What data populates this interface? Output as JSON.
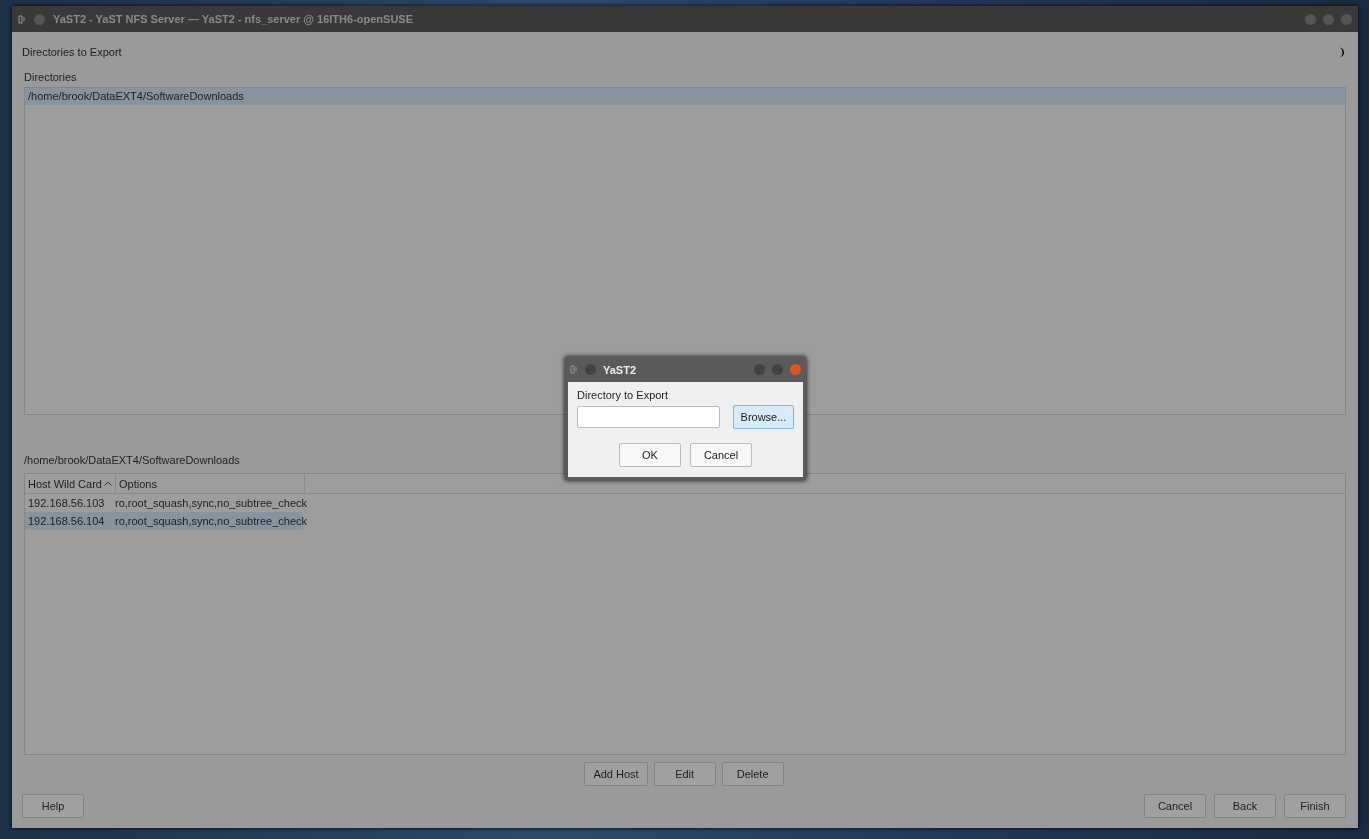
{
  "window": {
    "title": "YaST2 - YaST NFS Server — YaST2 - nfs_server @ 16ITH6-openSUSE"
  },
  "heading": "Directories to Export",
  "directories": {
    "label": "Directories",
    "items": [
      {
        "path": "/home/brook/DataEXT4/SoftwareDownloads",
        "selected": true
      }
    ]
  },
  "hosts": {
    "label": "/home/brook/DataEXT4/SoftwareDownloads",
    "columns": [
      {
        "title": "Host Wild Card",
        "sorted": true
      },
      {
        "title": "Options",
        "sorted": false
      }
    ],
    "rows": [
      {
        "host": "192.168.56.103",
        "options": "ro,root_squash,sync,no_subtree_check",
        "selected": false
      },
      {
        "host": "192.168.56.104",
        "options": "ro,root_squash,sync,no_subtree_check",
        "selected": true
      }
    ]
  },
  "host_buttons": [
    "Add Host",
    "Edit",
    "Delete"
  ],
  "help_button": "Help",
  "nav_buttons": [
    "Cancel",
    "Back",
    "Finish"
  ],
  "dialog": {
    "title": "YaST2",
    "field_label": "Directory to Export",
    "browse": {
      "label": "Browse...",
      "focused": true
    },
    "buttons": [
      "OK",
      "Cancel"
    ]
  }
}
